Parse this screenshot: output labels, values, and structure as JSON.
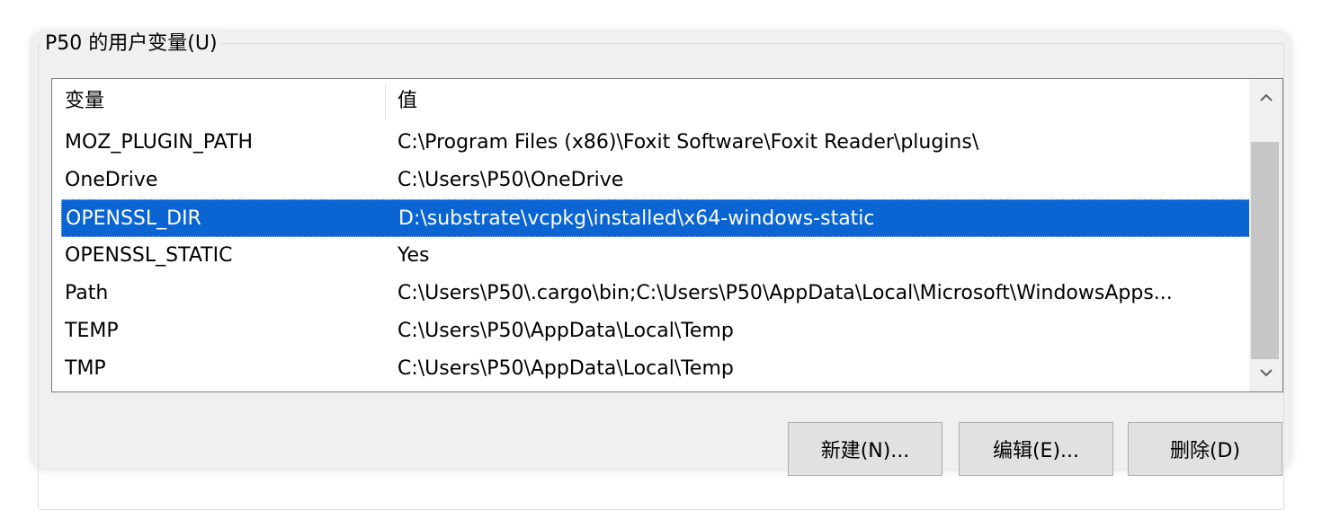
{
  "group": {
    "label": "P50 的用户变量(U)"
  },
  "list": {
    "columns": [
      "变量",
      "值"
    ],
    "rows": [
      {
        "name": "MOZ_PLUGIN_PATH",
        "value": "C:\\Program Files (x86)\\Foxit Software\\Foxit Reader\\plugins\\",
        "selected": false
      },
      {
        "name": "OneDrive",
        "value": "C:\\Users\\P50\\OneDrive",
        "selected": false
      },
      {
        "name": "OPENSSL_DIR",
        "value": "D:\\substrate\\vcpkg\\installed\\x64-windows-static",
        "selected": true
      },
      {
        "name": "OPENSSL_STATIC",
        "value": "Yes",
        "selected": false
      },
      {
        "name": "Path",
        "value": "C:\\Users\\P50\\.cargo\\bin;C:\\Users\\P50\\AppData\\Local\\Microsoft\\WindowsApps...",
        "selected": false
      },
      {
        "name": "TEMP",
        "value": "C:\\Users\\P50\\AppData\\Local\\Temp",
        "selected": false
      },
      {
        "name": "TMP",
        "value": "C:\\Users\\P50\\AppData\\Local\\Temp",
        "selected": false
      }
    ]
  },
  "scrollbar": {
    "up_icon": "chevron-up-icon",
    "down_icon": "chevron-down-icon"
  },
  "buttons": {
    "new_label": "新建(N)...",
    "edit_label": "编辑(E)...",
    "delete_label": "删除(D)"
  },
  "colors": {
    "selection": "#0a64d2",
    "window_bg": "#f0f0f0"
  }
}
